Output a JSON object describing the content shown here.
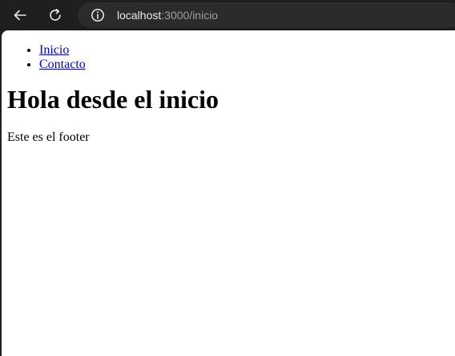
{
  "browser": {
    "url_host": "localhost",
    "url_rest": ":3000/inicio"
  },
  "icons": {
    "back": "arrow-left-icon",
    "reload": "reload-icon",
    "info": "info-icon"
  },
  "page": {
    "nav_links": [
      {
        "label": "Inicio"
      },
      {
        "label": "Contacto"
      }
    ],
    "heading": "Hola desde el inicio",
    "footer": "Este es el footer"
  },
  "colors": {
    "chrome_bg": "#1f1f1f",
    "omnibox_bg": "#2b2b2b",
    "link": "#0000ee"
  }
}
